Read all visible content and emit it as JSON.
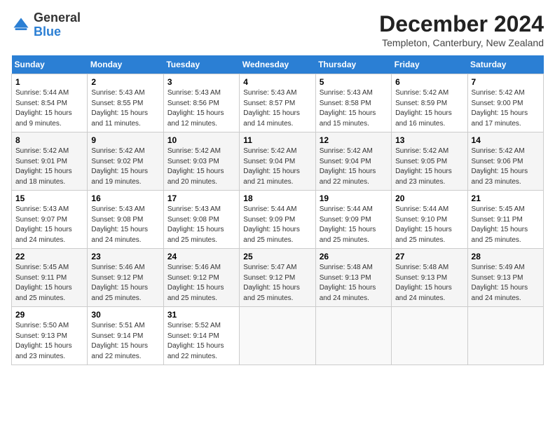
{
  "logo": {
    "general": "General",
    "blue": "Blue"
  },
  "header": {
    "title": "December 2024",
    "subtitle": "Templeton, Canterbury, New Zealand"
  },
  "days_of_week": [
    "Sunday",
    "Monday",
    "Tuesday",
    "Wednesday",
    "Thursday",
    "Friday",
    "Saturday"
  ],
  "weeks": [
    [
      {
        "day": "1",
        "info": "Sunrise: 5:44 AM\nSunset: 8:54 PM\nDaylight: 15 hours\nand 9 minutes."
      },
      {
        "day": "2",
        "info": "Sunrise: 5:43 AM\nSunset: 8:55 PM\nDaylight: 15 hours\nand 11 minutes."
      },
      {
        "day": "3",
        "info": "Sunrise: 5:43 AM\nSunset: 8:56 PM\nDaylight: 15 hours\nand 12 minutes."
      },
      {
        "day": "4",
        "info": "Sunrise: 5:43 AM\nSunset: 8:57 PM\nDaylight: 15 hours\nand 14 minutes."
      },
      {
        "day": "5",
        "info": "Sunrise: 5:43 AM\nSunset: 8:58 PM\nDaylight: 15 hours\nand 15 minutes."
      },
      {
        "day": "6",
        "info": "Sunrise: 5:42 AM\nSunset: 8:59 PM\nDaylight: 15 hours\nand 16 minutes."
      },
      {
        "day": "7",
        "info": "Sunrise: 5:42 AM\nSunset: 9:00 PM\nDaylight: 15 hours\nand 17 minutes."
      }
    ],
    [
      {
        "day": "8",
        "info": "Sunrise: 5:42 AM\nSunset: 9:01 PM\nDaylight: 15 hours\nand 18 minutes."
      },
      {
        "day": "9",
        "info": "Sunrise: 5:42 AM\nSunset: 9:02 PM\nDaylight: 15 hours\nand 19 minutes."
      },
      {
        "day": "10",
        "info": "Sunrise: 5:42 AM\nSunset: 9:03 PM\nDaylight: 15 hours\nand 20 minutes."
      },
      {
        "day": "11",
        "info": "Sunrise: 5:42 AM\nSunset: 9:04 PM\nDaylight: 15 hours\nand 21 minutes."
      },
      {
        "day": "12",
        "info": "Sunrise: 5:42 AM\nSunset: 9:04 PM\nDaylight: 15 hours\nand 22 minutes."
      },
      {
        "day": "13",
        "info": "Sunrise: 5:42 AM\nSunset: 9:05 PM\nDaylight: 15 hours\nand 23 minutes."
      },
      {
        "day": "14",
        "info": "Sunrise: 5:42 AM\nSunset: 9:06 PM\nDaylight: 15 hours\nand 23 minutes."
      }
    ],
    [
      {
        "day": "15",
        "info": "Sunrise: 5:43 AM\nSunset: 9:07 PM\nDaylight: 15 hours\nand 24 minutes."
      },
      {
        "day": "16",
        "info": "Sunrise: 5:43 AM\nSunset: 9:08 PM\nDaylight: 15 hours\nand 24 minutes."
      },
      {
        "day": "17",
        "info": "Sunrise: 5:43 AM\nSunset: 9:08 PM\nDaylight: 15 hours\nand 25 minutes."
      },
      {
        "day": "18",
        "info": "Sunrise: 5:44 AM\nSunset: 9:09 PM\nDaylight: 15 hours\nand 25 minutes."
      },
      {
        "day": "19",
        "info": "Sunrise: 5:44 AM\nSunset: 9:09 PM\nDaylight: 15 hours\nand 25 minutes."
      },
      {
        "day": "20",
        "info": "Sunrise: 5:44 AM\nSunset: 9:10 PM\nDaylight: 15 hours\nand 25 minutes."
      },
      {
        "day": "21",
        "info": "Sunrise: 5:45 AM\nSunset: 9:11 PM\nDaylight: 15 hours\nand 25 minutes."
      }
    ],
    [
      {
        "day": "22",
        "info": "Sunrise: 5:45 AM\nSunset: 9:11 PM\nDaylight: 15 hours\nand 25 minutes."
      },
      {
        "day": "23",
        "info": "Sunrise: 5:46 AM\nSunset: 9:12 PM\nDaylight: 15 hours\nand 25 minutes."
      },
      {
        "day": "24",
        "info": "Sunrise: 5:46 AM\nSunset: 9:12 PM\nDaylight: 15 hours\nand 25 minutes."
      },
      {
        "day": "25",
        "info": "Sunrise: 5:47 AM\nSunset: 9:12 PM\nDaylight: 15 hours\nand 25 minutes."
      },
      {
        "day": "26",
        "info": "Sunrise: 5:48 AM\nSunset: 9:13 PM\nDaylight: 15 hours\nand 24 minutes."
      },
      {
        "day": "27",
        "info": "Sunrise: 5:48 AM\nSunset: 9:13 PM\nDaylight: 15 hours\nand 24 minutes."
      },
      {
        "day": "28",
        "info": "Sunrise: 5:49 AM\nSunset: 9:13 PM\nDaylight: 15 hours\nand 24 minutes."
      }
    ],
    [
      {
        "day": "29",
        "info": "Sunrise: 5:50 AM\nSunset: 9:13 PM\nDaylight: 15 hours\nand 23 minutes."
      },
      {
        "day": "30",
        "info": "Sunrise: 5:51 AM\nSunset: 9:14 PM\nDaylight: 15 hours\nand 22 minutes."
      },
      {
        "day": "31",
        "info": "Sunrise: 5:52 AM\nSunset: 9:14 PM\nDaylight: 15 hours\nand 22 minutes."
      },
      {
        "day": "",
        "info": ""
      },
      {
        "day": "",
        "info": ""
      },
      {
        "day": "",
        "info": ""
      },
      {
        "day": "",
        "info": ""
      }
    ]
  ]
}
